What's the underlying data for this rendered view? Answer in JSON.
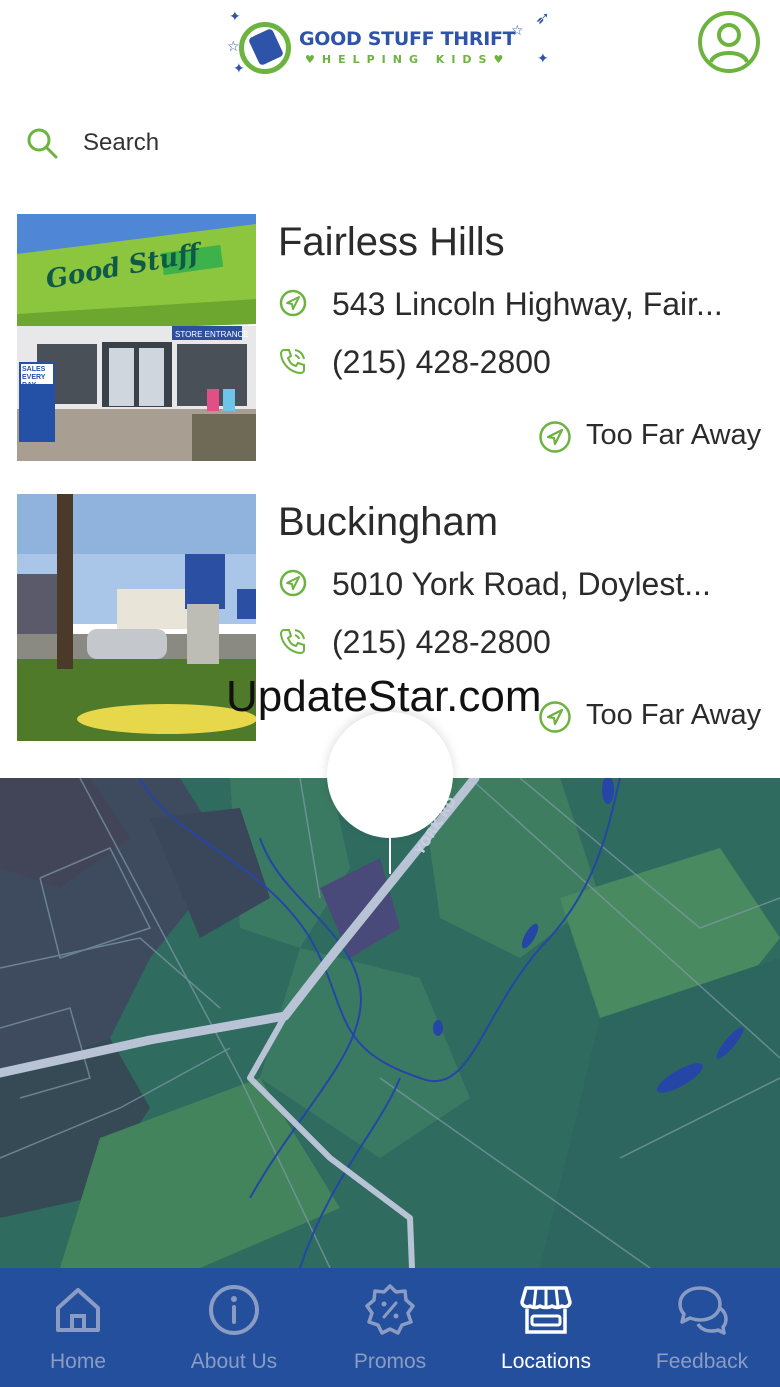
{
  "header": {
    "logo_title": "GOOD STUFF THRIFT",
    "logo_subtitle": "♥HELPING KIDS♥",
    "profile_icon": "user-icon"
  },
  "search": {
    "placeholder": "Search",
    "icon": "search-icon"
  },
  "stores": [
    {
      "name": "Fairless Hills",
      "address": "543 Lincoln Highway, Fair...",
      "phone": "(215) 428-2800",
      "distance": "Too Far Away",
      "photo_sign": "Good Stuff",
      "photo_entrance": "STORE ENTRANCE",
      "photo_banner": "SALES EVERY DAY"
    },
    {
      "name": "Buckingham",
      "address": "5010 York Road, Doylest...",
      "phone": "(215) 428-2800",
      "distance": "Too Far Away"
    }
  ],
  "watermark": "UpdateStar.com",
  "map": {
    "road_label": "YORK RD"
  },
  "tabs": [
    {
      "label": "Home",
      "icon": "home-icon",
      "active": false
    },
    {
      "label": "About Us",
      "icon": "info-icon",
      "active": false
    },
    {
      "label": "Promos",
      "icon": "percent-badge-icon",
      "active": false
    },
    {
      "label": "Locations",
      "icon": "storefront-icon",
      "active": true
    },
    {
      "label": "Feedback",
      "icon": "chat-bubbles-icon",
      "active": false
    }
  ],
  "colors": {
    "brand_blue": "#2d54a8",
    "brand_green": "#6db33f",
    "tabbar": "#234f9c",
    "tab_inactive": "#8a9cc4",
    "tab_active": "#ffffff",
    "map_base": "#2f6b5f"
  }
}
